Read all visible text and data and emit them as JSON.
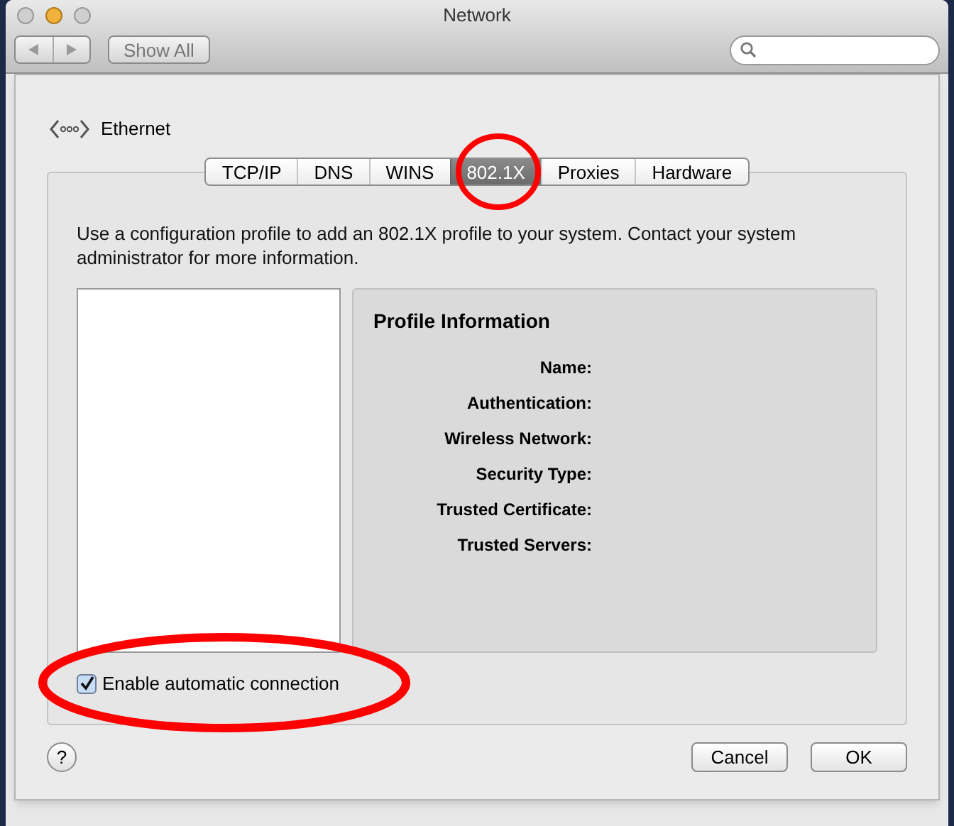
{
  "window": {
    "title": "Network"
  },
  "toolbar": {
    "show_all": "Show All"
  },
  "service": {
    "name": "Ethernet"
  },
  "tabs": [
    {
      "label": "TCP/IP",
      "selected": false
    },
    {
      "label": "DNS",
      "selected": false
    },
    {
      "label": "WINS",
      "selected": false
    },
    {
      "label": "802.1X",
      "selected": true
    },
    {
      "label": "Proxies",
      "selected": false
    },
    {
      "label": "Hardware",
      "selected": false
    }
  ],
  "description": "Use a configuration profile to add an 802.1X profile to your system. Contact your system administrator for more information.",
  "profile_panel": {
    "title": "Profile Information",
    "fields": [
      "Name:",
      "Authentication:",
      "Wireless Network:",
      "Security Type:",
      "Trusted Certificate:",
      "Trusted Servers:"
    ]
  },
  "auto_connect": {
    "label": "Enable automatic connection",
    "checked": true
  },
  "help": {
    "label": "?"
  },
  "buttons": [
    {
      "label": "Cancel"
    },
    {
      "label": "OK"
    }
  ]
}
